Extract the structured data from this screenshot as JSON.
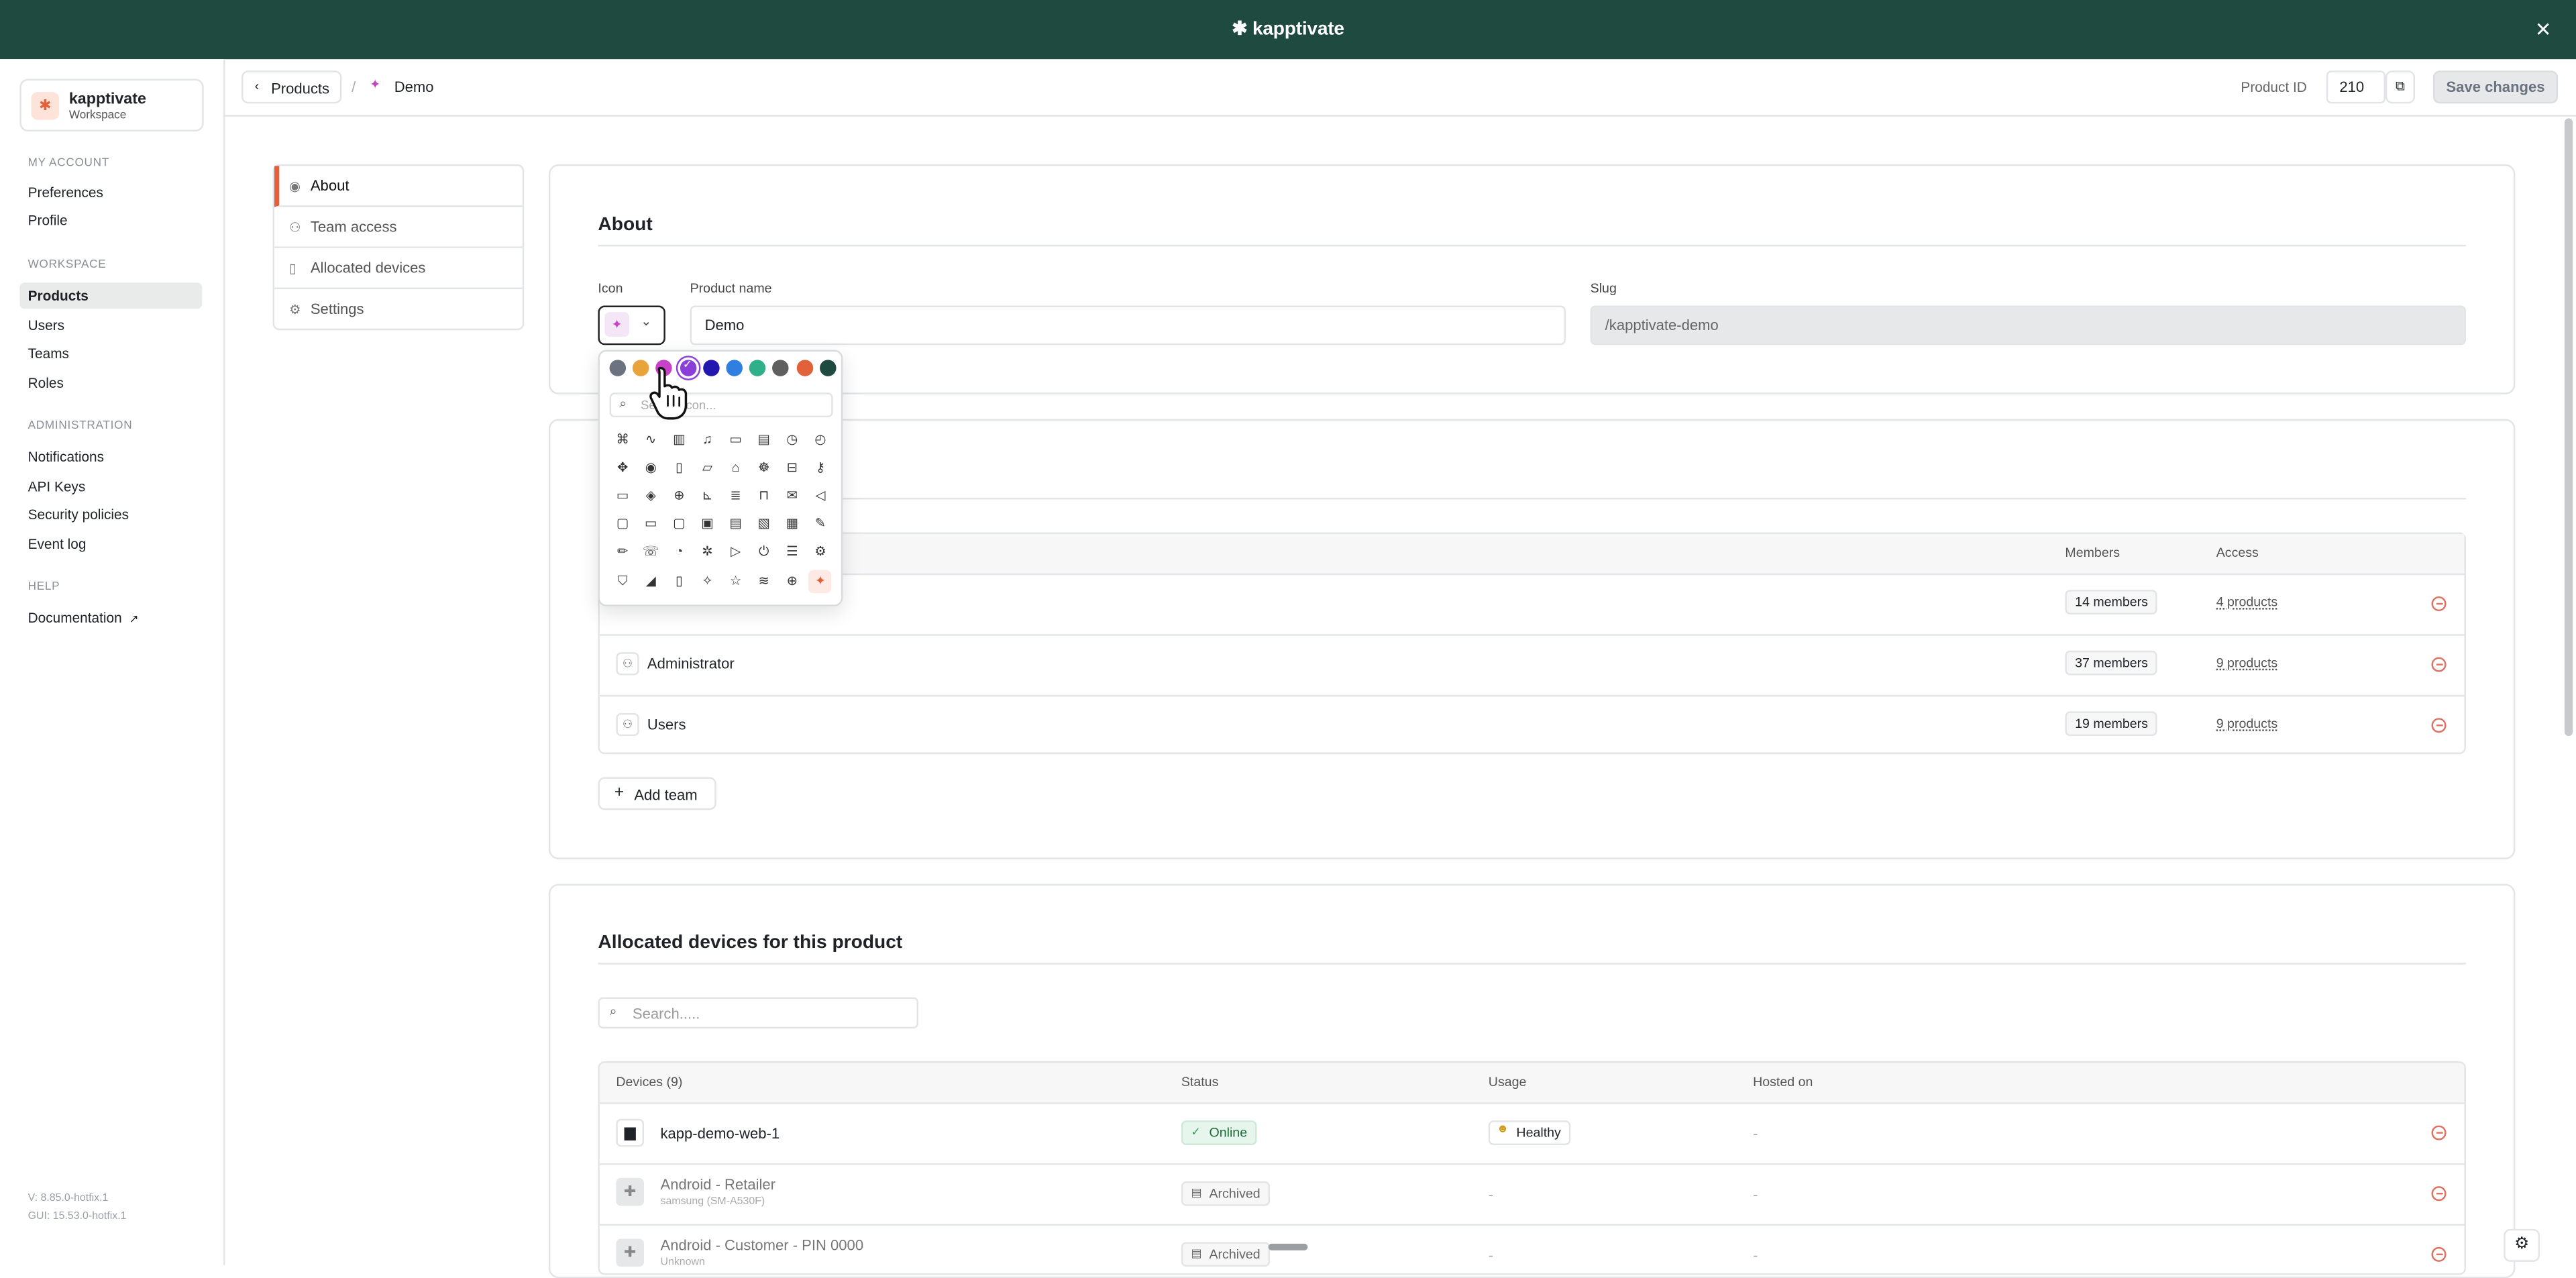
{
  "app": {
    "brand": "kapptivate",
    "close_icon": "close-icon"
  },
  "workspace": {
    "name": "kapptivate",
    "subtitle": "Workspace"
  },
  "sidebar": {
    "my_account": {
      "title": "MY ACCOUNT",
      "items": [
        "Preferences",
        "Profile"
      ]
    },
    "workspace": {
      "title": "WORKSPACE",
      "items": [
        "Products",
        "Users",
        "Teams",
        "Roles"
      ],
      "active": "Products"
    },
    "administration": {
      "title": "ADMINISTRATION",
      "items": [
        "Notifications",
        "API Keys",
        "Security policies",
        "Event log"
      ]
    },
    "help": {
      "title": "HELP",
      "items": [
        "Documentation"
      ]
    },
    "version": "V: 8.85.0-hotfix.1",
    "gui": "GUI: 15.53.0-hotfix.1"
  },
  "header": {
    "back_label": "Products",
    "separator": "/",
    "current": "Demo",
    "product_id_label": "Product ID",
    "product_id": "210",
    "save_label": "Save changes"
  },
  "subnav": [
    "About",
    "Team access",
    "Allocated devices",
    "Settings"
  ],
  "about": {
    "title": "About",
    "icon_label": "Icon",
    "name_label": "Product name",
    "name_value": "Demo",
    "slug_label": "Slug",
    "slug_value": "/kapptivate-demo"
  },
  "picker": {
    "colors": [
      "#6b7280",
      "#e8a33a",
      "#c640c8",
      "#8b3fd9",
      "#2218b0",
      "#2f7fe0",
      "#2fb08a",
      "#5f5f5f",
      "#e2603a",
      "#1f4a40"
    ],
    "selected_color_index": 3,
    "search_placeholder": "Search icon...",
    "icons": [
      "command-icon",
      "activity-icon",
      "bar-chart-icon",
      "bell-icon",
      "book-icon",
      "clipboard-icon",
      "clock-icon",
      "timer-icon",
      "move-icon",
      "eye-icon",
      "file-icon",
      "folder-icon",
      "graduation-icon",
      "bug-icon",
      "inbox-icon",
      "key-icon",
      "laptop-icon",
      "layers-icon",
      "globe-icon",
      "line-chart-icon",
      "list-icon",
      "lock-icon",
      "mail-icon",
      "megaphone-icon",
      "chat-icon",
      "monitor-icon",
      "message-icon",
      "message-square-icon",
      "messages-icon",
      "sticky-note-icon",
      "calendar-icon",
      "pen-tool-icon",
      "pencil-icon",
      "phone-icon",
      "pie-chart-icon",
      "pinwheel-icon",
      "play-icon",
      "power-icon",
      "server-icon",
      "settings-icon",
      "shield-icon",
      "signal-icon",
      "smartphone-icon",
      "sparkle-icon",
      "star-icon",
      "wifi-icon",
      "world-icon",
      "kapptivate-icon"
    ],
    "selected_icon": "kapptivate-icon"
  },
  "teams": {
    "col_members": "Members",
    "col_access": "Access",
    "rows": [
      {
        "name": "",
        "members": "14 members",
        "access": "4 products"
      },
      {
        "name": "Administrator",
        "members": "37 members",
        "access": "9 products"
      },
      {
        "name": "Users",
        "members": "19 members",
        "access": "9 products"
      }
    ],
    "add_label": "Add team"
  },
  "devices": {
    "title": "Allocated devices for this product",
    "search_placeholder": "Search.....",
    "cols": [
      "Devices (9)",
      "Status",
      "Usage",
      "Hosted on"
    ],
    "rows": [
      {
        "name": "kapp-demo-web-1",
        "sub": "",
        "status": "Online",
        "usage": "Healthy",
        "hosted": "-"
      },
      {
        "name": "Android - Retailer",
        "sub": "samsung (SM-A530F)",
        "status": "Archived",
        "usage": "-",
        "hosted": "-"
      },
      {
        "name": "Android - Customer - PIN 0000",
        "sub": "Unknown",
        "status": "Archived",
        "usage": "-",
        "hosted": "-"
      }
    ]
  }
}
